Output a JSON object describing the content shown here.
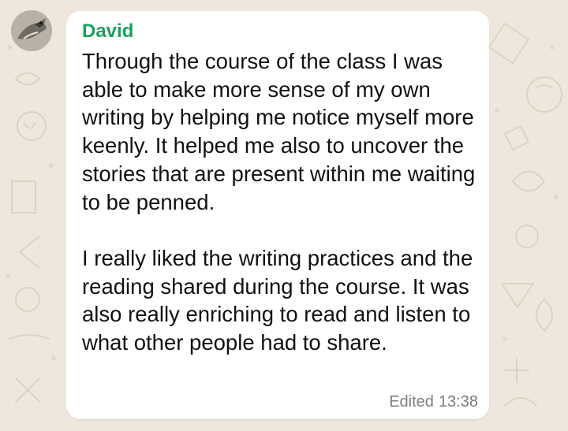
{
  "chat": {
    "sender_name": "David",
    "message_paragraphs": [
      "Through the course of the class I was able to make more sense of my own writing by helping me notice myself more keenly. It helped me also to uncover the stories that are present within me waiting to be penned.",
      "I really liked the writing practices and the reading shared during the course. It was also really enriching to read and listen to what other people had to share."
    ],
    "edited_label": "Edited",
    "timestamp": "13:38",
    "sender_name_color": "#1aa05a",
    "bubble_color": "#ffffff",
    "wallpaper_color": "#efe7dc"
  }
}
